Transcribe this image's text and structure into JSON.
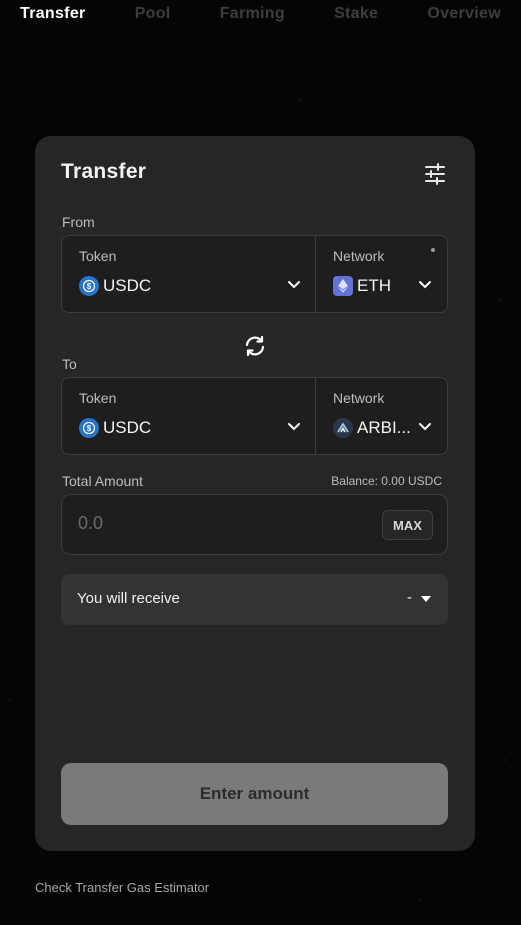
{
  "nav": {
    "items": [
      "Transfer",
      "Pool",
      "Farming",
      "Stake",
      "Overview"
    ],
    "active": "Transfer"
  },
  "card": {
    "title": "Transfer",
    "settings_icon": "sliders-icon"
  },
  "from": {
    "label": "From",
    "token_caption": "Token",
    "token_value": "USDC",
    "token_icon": "usdc-icon",
    "network_caption": "Network",
    "network_value": "ETH",
    "network_icon": "ethereum-icon"
  },
  "swap_icon": "swap-arrows-icon",
  "to": {
    "label": "To",
    "token_caption": "Token",
    "token_value": "USDC",
    "token_icon": "usdc-icon",
    "network_caption": "Network",
    "network_value": "ARBI...",
    "network_icon": "arbitrum-icon"
  },
  "amount": {
    "label": "Total Amount",
    "balance": "Balance: 0.00 USDC",
    "placeholder": "0.0",
    "max_label": "MAX"
  },
  "receive": {
    "label": "You will receive",
    "value": "-"
  },
  "submit_label": "Enter amount",
  "footer_link": "Check Transfer Gas Estimator",
  "colors": {
    "background": "#050505",
    "card": "#262626",
    "usdc": "#2775ca",
    "eth": "#6272d6",
    "button_disabled": "#7a7a7a"
  }
}
